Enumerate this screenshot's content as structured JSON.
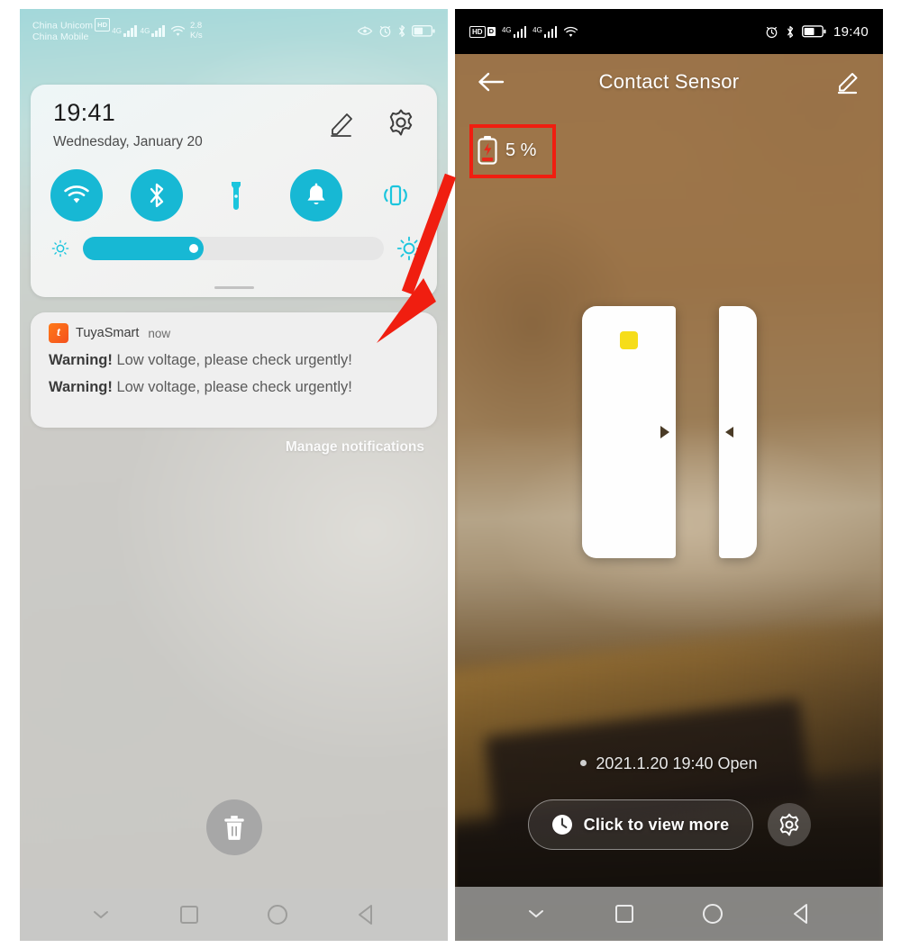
{
  "left_phone": {
    "status_bar": {
      "carrier_primary": "China Unicom",
      "carrier_hd_badge": "HD",
      "carrier_secondary": "China Mobile",
      "network_type_1": "4G",
      "network_type_2": "4G",
      "net_speed_value": "2.8",
      "net_speed_unit": "K/s",
      "icons": [
        "eye-off-icon",
        "alarm-icon",
        "bluetooth-icon",
        "battery-icon"
      ]
    },
    "quick_settings": {
      "time": "19:41",
      "date": "Wednesday, January 20",
      "edit_icon": "pencil-icon",
      "settings_icon": "gear-icon",
      "tiles": [
        {
          "name": "wifi",
          "icon": "wifi-icon",
          "active": true
        },
        {
          "name": "bluetooth",
          "icon": "bluetooth-icon",
          "active": true
        },
        {
          "name": "flashlight",
          "icon": "flashlight-icon",
          "active": false
        },
        {
          "name": "ring",
          "icon": "bell-icon",
          "active": true
        },
        {
          "name": "vibrate",
          "icon": "vibrate-icon",
          "active": false
        }
      ],
      "brightness": {
        "low_icon": "brightness-low-icon",
        "high_icon": "brightness-high-icon",
        "value_percent": 40
      },
      "accent_color": "#17b8d4"
    },
    "notification": {
      "app_icon": "tuyasmart-app-icon",
      "app_name": "TuyaSmart",
      "time": "now",
      "lines": [
        {
          "bold": "Warning!",
          "text": " Low voltage, please check urgently!"
        },
        {
          "bold": "Warning!",
          "text": " Low voltage, please check urgently!"
        }
      ]
    },
    "manage_notifications_label": "Manage notifications",
    "clear_all_icon": "trash-icon",
    "nav_bar": [
      "chevron-down-icon",
      "square-icon",
      "circle-icon",
      "back-triangle-icon"
    ]
  },
  "right_phone": {
    "status_bar": {
      "hd_badge": "HD",
      "data_badge": "D",
      "network_type_1": "4G",
      "network_type_2": "4G",
      "wifi_icon": "wifi-icon",
      "alarm_icon": "alarm-icon",
      "bluetooth_icon": "bluetooth-icon",
      "battery_icon": "battery-icon",
      "clock": "19:40"
    },
    "header": {
      "back_icon": "back-arrow-icon",
      "title": "Contact Sensor",
      "edit_icon": "pencil-icon"
    },
    "battery_badge": {
      "icon": "battery-low-icon",
      "label": "5 %",
      "highlight_color": "#f01e10"
    },
    "device_illustration": {
      "led_color": "#f6dd19",
      "body_icon": "contact-sensor-body",
      "magnet_icon": "contact-sensor-magnet"
    },
    "status_line": "2021.1.20 19:40 Open",
    "view_more_button": {
      "icon": "clock-icon",
      "label": "Click to view more"
    },
    "settings_button_icon": "gear-icon",
    "nav_bar": [
      "chevron-down-icon",
      "square-icon",
      "circle-icon",
      "back-triangle-icon"
    ]
  },
  "annotations": {
    "arrow_color": "#f01e10",
    "arrow_name": "red-pointer-arrow",
    "box_name": "red-highlight-box"
  }
}
